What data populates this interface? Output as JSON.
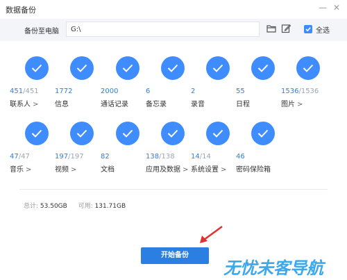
{
  "window": {
    "title": "数据备份",
    "minimize_icon": "minimize-icon",
    "close_icon": "close-icon"
  },
  "pathbar": {
    "label": "备份至电脑",
    "path_value": "G:\\",
    "folder_icon": "folder-icon",
    "edit_icon": "edit-icon",
    "select_all_label": "全选",
    "select_all_checked": true
  },
  "categories": [
    {
      "count": "451",
      "sep": "/",
      "total": "451",
      "name": "联系人",
      "arrow": ">",
      "checked": true
    },
    {
      "count": "1772",
      "sep": "",
      "total": "",
      "name": "信息",
      "arrow": "",
      "checked": true
    },
    {
      "count": "2000",
      "sep": "",
      "total": "",
      "name": "通话记录",
      "arrow": "",
      "checked": true
    },
    {
      "count": "6",
      "sep": "",
      "total": "",
      "name": "备忘录",
      "arrow": "",
      "checked": true
    },
    {
      "count": "2",
      "sep": "",
      "total": "",
      "name": "录音",
      "arrow": "",
      "checked": true
    },
    {
      "count": "55",
      "sep": "",
      "total": "",
      "name": "日程",
      "arrow": "",
      "checked": true
    },
    {
      "count": "1536",
      "sep": "/",
      "total": "1536",
      "name": "图片",
      "arrow": ">",
      "checked": true
    },
    {
      "count": "47",
      "sep": "/",
      "total": "47",
      "name": "音乐",
      "arrow": ">",
      "checked": true
    },
    {
      "count": "197",
      "sep": "/",
      "total": "197",
      "name": "视频",
      "arrow": ">",
      "checked": true
    },
    {
      "count": "82",
      "sep": "",
      "total": "",
      "name": "文档",
      "arrow": "",
      "checked": true
    },
    {
      "count": "138",
      "sep": "/",
      "total": "138",
      "name": "应用及数据",
      "arrow": ">",
      "checked": true
    },
    {
      "count": "14",
      "sep": "/",
      "total": "14",
      "name": "系统设置",
      "arrow": ">",
      "checked": true
    },
    {
      "count": "46",
      "sep": "",
      "total": "",
      "name": "密码保险箱",
      "arrow": "",
      "checked": true
    }
  ],
  "summary": {
    "total_label": "总计:",
    "total_value": "53.50GB",
    "available_label": "可用:",
    "available_value": "131.71GB"
  },
  "start_button": {
    "label": "开始备份"
  },
  "watermark": {
    "text": "无忧未客导航"
  },
  "colors": {
    "accent": "#3f8cff",
    "button": "#2b7fe3",
    "count": "#2b7fe3",
    "arrow": "#e0312f"
  }
}
